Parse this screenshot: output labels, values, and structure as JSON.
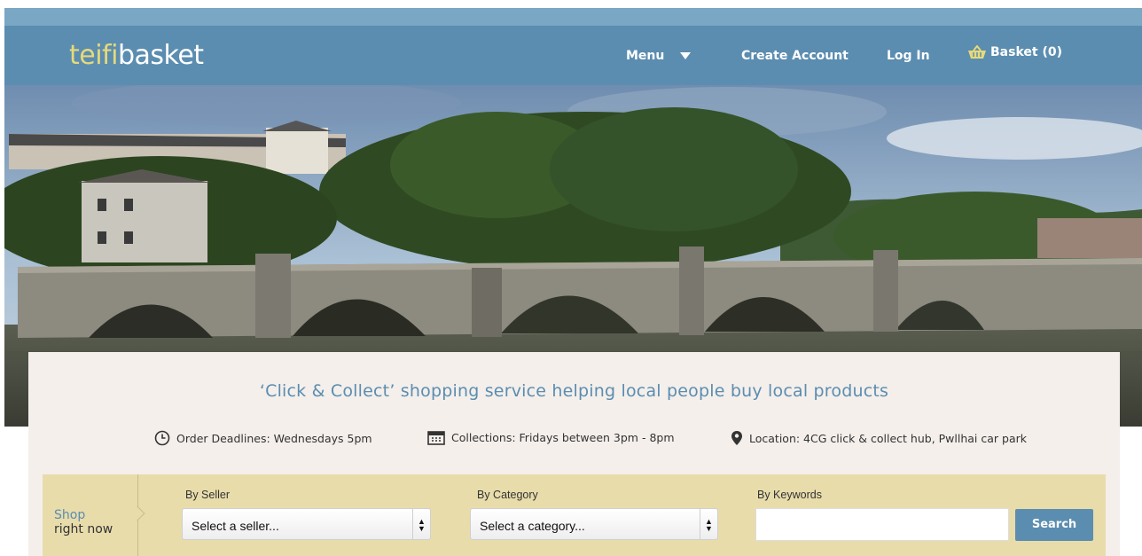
{
  "header": {
    "logo_part1": "teifi",
    "logo_part2": "basket",
    "nav": {
      "menu": "Menu",
      "create_account": "Create Account",
      "log_in": "Log In",
      "basket": "Basket (0)"
    }
  },
  "hero": {
    "tagline": "‘Click & Collect’ shopping service helping local people buy local products"
  },
  "info": {
    "deadlines": "Order Deadlines: Wednesdays 5pm",
    "collections": "Collections: Fridays between 3pm - 8pm",
    "location": "Location: 4CG click & collect hub, Pwllhai car park"
  },
  "shop": {
    "label_line1": "Shop",
    "label_line2": "right now",
    "by_seller_label": "By Seller",
    "seller_value": "Select a seller...",
    "by_category_label": "By Category",
    "category_value": "Select a category...",
    "by_keywords_label": "By Keywords",
    "keywords_value": "",
    "search_button": "Search"
  },
  "colors": {
    "nav_blue": "#5b8db0",
    "logo_yellow": "#e6d97a",
    "shopbar_tan": "#e8dcab",
    "panel_bg": "#f4efeb"
  },
  "icons": [
    "basket-icon",
    "clock-icon",
    "calendar-icon",
    "location-pin-icon",
    "chevron-down-icon"
  ]
}
